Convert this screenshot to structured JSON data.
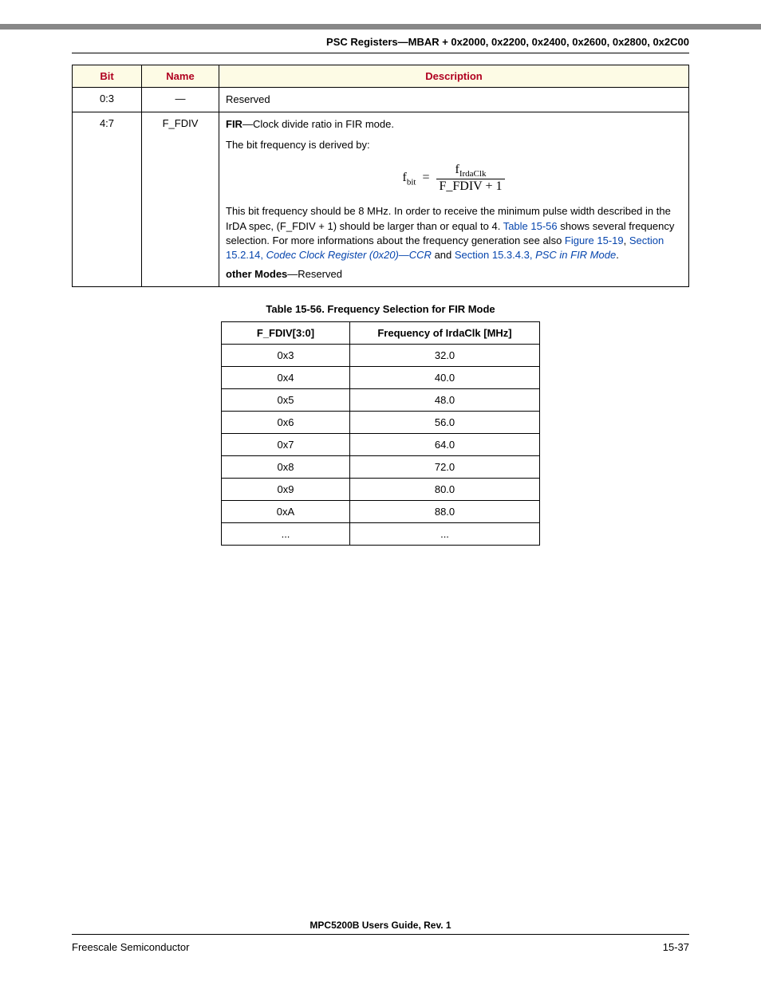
{
  "header": {
    "title": "PSC Registers—MBAR + 0x2000, 0x2200, 0x2400, 0x2600, 0x2800, 0x2C00"
  },
  "reg_table": {
    "headers": {
      "bit": "Bit",
      "name": "Name",
      "desc": "Description"
    },
    "rows": [
      {
        "bit": "0:3",
        "name": "—",
        "desc_plain": "Reserved"
      }
    ],
    "row2": {
      "bit": "4:7",
      "name": "F_FDIV",
      "fir_label": "FIR",
      "fir_suffix": "—Clock divide ratio in FIR mode.",
      "line2": "The bit frequency is derived by:",
      "formula": {
        "lhs_base": "f",
        "lhs_sub": "bit",
        "num_base": "f",
        "num_sub": "IrdaClk",
        "den": "F_FDIV + 1"
      },
      "para_a": "This bit frequency should be 8 MHz. In order to receive the minimum pulse width described in the IrDA spec, (F_FDIV + 1) should be larger than or equal to 4. ",
      "link1": "Table 15-56",
      "para_b": " shows several frequency selection. For more informations about the frequency generation see also ",
      "link2": "Figure 15-19",
      "comma1": ", ",
      "link3_pre": "Section 15.2.14, ",
      "link3_ital": "Codec Clock Register (0x20)—CCR",
      "and": " and ",
      "link4_pre": "Section 15.3.4.3, ",
      "link4_ital": "PSC in FIR Mode",
      "period": ".",
      "other_label": "other Modes",
      "other_suffix": "—Reserved"
    }
  },
  "freq_caption": "Table 15-56. Frequency Selection for FIR Mode",
  "freq_table": {
    "headers": {
      "col1": "F_FDIV[3:0]",
      "col2": "Frequency of IrdaClk [MHz]"
    },
    "rows": [
      {
        "a": "0x3",
        "b": "32.0"
      },
      {
        "a": "0x4",
        "b": "40.0"
      },
      {
        "a": "0x5",
        "b": "48.0"
      },
      {
        "a": "0x6",
        "b": "56.0"
      },
      {
        "a": "0x7",
        "b": "64.0"
      },
      {
        "a": "0x8",
        "b": "72.0"
      },
      {
        "a": "0x9",
        "b": "80.0"
      },
      {
        "a": "0xA",
        "b": "88.0"
      },
      {
        "a": "...",
        "b": "..."
      }
    ]
  },
  "footer": {
    "title": "MPC5200B Users Guide, Rev. 1",
    "left": "Freescale Semiconductor",
    "right": "15-37"
  }
}
